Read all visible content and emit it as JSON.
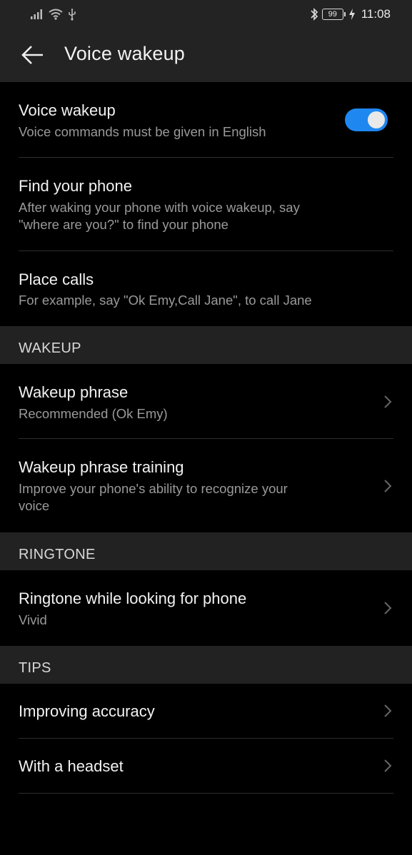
{
  "status_bar": {
    "time": "11:08",
    "battery": "99",
    "icons": [
      "signal-icon",
      "wifi-icon",
      "usb-icon",
      "bluetooth-icon",
      "battery-icon",
      "charging-icon"
    ]
  },
  "app_bar": {
    "title": "Voice wakeup",
    "back_icon": "back-arrow-icon"
  },
  "main_settings": [
    {
      "title": "Voice wakeup",
      "subtitle": "Voice commands must be given in English",
      "toggle_on": true
    },
    {
      "title": "Find your phone",
      "subtitle_lines": [
        "After waking your phone with voice wakeup, say",
        "\"where are you?\" to find your phone"
      ]
    },
    {
      "title": "Place calls",
      "subtitle": "For example, say \"Ok Emy,Call Jane\", to call Jane"
    }
  ],
  "wakeup_section": {
    "header": "WAKEUP",
    "items": [
      {
        "title": "Wakeup phrase",
        "subtitle": "Recommended (Ok Emy)"
      },
      {
        "title": "Wakeup phrase training",
        "subtitle_lines": [
          "Improve your phone's ability to recognize your",
          "voice"
        ]
      }
    ]
  },
  "ringtone_section": {
    "header": "RINGTONE",
    "items": [
      {
        "title": "Ringtone while looking for phone",
        "subtitle": "Vivid"
      }
    ]
  },
  "tips_section": {
    "header": "TIPS",
    "items": [
      {
        "title": "Improving accuracy"
      },
      {
        "title": "With a headset"
      }
    ]
  },
  "colors": {
    "accent": "#1e88f0",
    "background": "#000000",
    "header_background": "#232323",
    "secondary_text": "#9a9a9a"
  }
}
